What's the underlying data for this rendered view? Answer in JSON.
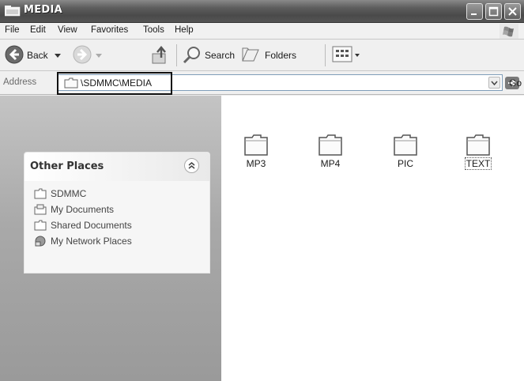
{
  "window": {
    "title": "MEDIA",
    "controls": [
      "minimize",
      "maximize",
      "close"
    ]
  },
  "menu": {
    "items": [
      "File",
      "Edit",
      "View",
      "Favorites",
      "Tools",
      "Help"
    ]
  },
  "toolbar": {
    "back_label": "Back",
    "search_label": "Search",
    "folders_label": "Folders"
  },
  "address": {
    "label": "Address",
    "value": "\\SDMMC\\MEDIA",
    "go_label": "Go"
  },
  "sidebar": {
    "panel_title": "Other Places",
    "items": [
      {
        "label": "SDMMC",
        "icon": "folder-icon"
      },
      {
        "label": "My Documents",
        "icon": "my-documents-icon"
      },
      {
        "label": "Shared Documents",
        "icon": "folder-icon"
      },
      {
        "label": "My Network Places",
        "icon": "network-icon"
      }
    ]
  },
  "content": {
    "folders": [
      {
        "name": "MP3",
        "selected": false
      },
      {
        "name": "MP4",
        "selected": false
      },
      {
        "name": "PIC",
        "selected": false
      },
      {
        "name": "TEXT",
        "selected": true
      }
    ]
  }
}
